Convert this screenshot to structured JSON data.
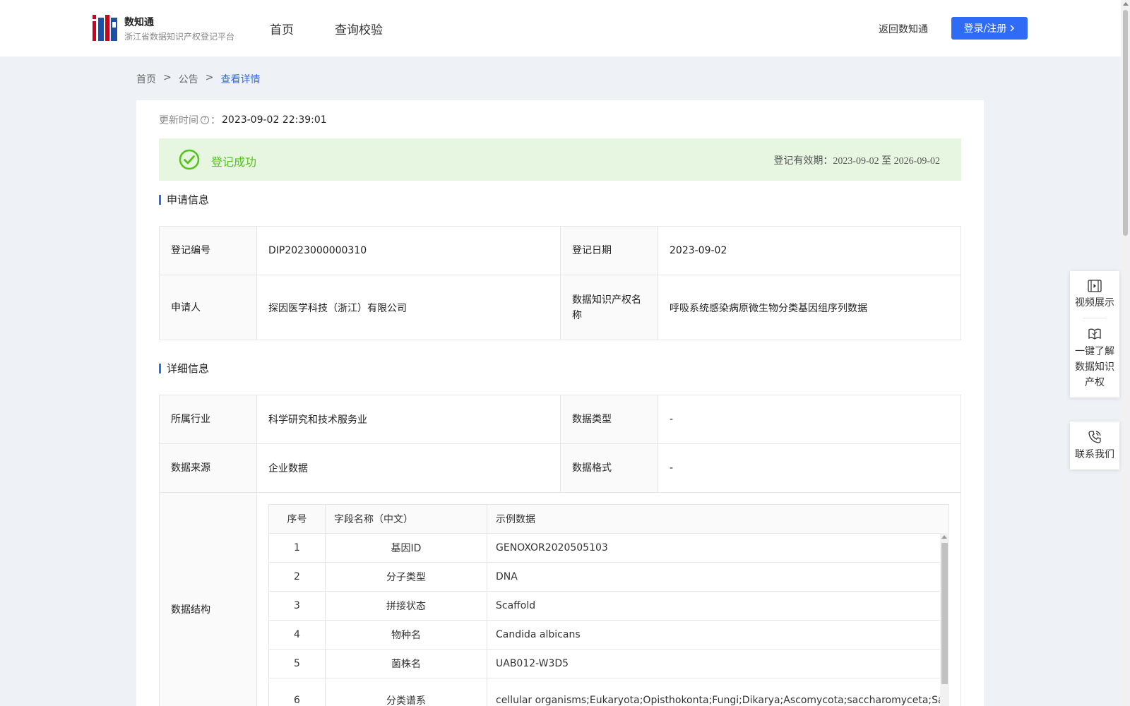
{
  "header": {
    "brand_title": "数知通",
    "brand_subtitle": "浙江省数据知识产权登记平台",
    "nav": [
      "首页",
      "查询校验"
    ],
    "back_link": "返回数知通",
    "login_label": "登录/注册"
  },
  "breadcrumb": {
    "items": [
      "首页",
      "公告",
      "查看详情"
    ],
    "separator": ">"
  },
  "update": {
    "label": "更新时间",
    "colon": "：",
    "value": "2023-09-02 22:39:01"
  },
  "status": {
    "text": "登记成功",
    "validity_label": "登记有效期：",
    "validity_range": "2023-09-02 至 2026-09-02",
    "color": "#52c41a"
  },
  "application": {
    "title": "申请信息",
    "reg_no_label": "登记编号",
    "reg_no": "DIP2023000000310",
    "reg_date_label": "登记日期",
    "reg_date": "2023-09-02",
    "applicant_label": "申请人",
    "applicant": "探因医学科技（浙江）有限公司",
    "ip_name_label": "数据知识产权名称",
    "ip_name": "呼吸系统感染病原微生物分类基因组序列数据"
  },
  "details": {
    "title": "详细信息",
    "industry_label": "所属行业",
    "industry": "科学研究和技术服务业",
    "data_type_label": "数据类型",
    "data_type": "-",
    "source_label": "数据来源",
    "source": "企业数据",
    "format_label": "数据格式",
    "format": "-",
    "structure_label": "数据结构"
  },
  "structure_table": {
    "headers": [
      "序号",
      "字段名称（中文）",
      "示例数据"
    ],
    "rows": [
      {
        "no": "1",
        "field": "基因ID",
        "sample": "GENOXOR2020505103"
      },
      {
        "no": "2",
        "field": "分子类型",
        "sample": "DNA"
      },
      {
        "no": "3",
        "field": "拼接状态",
        "sample": "Scaffold"
      },
      {
        "no": "4",
        "field": "物种名",
        "sample": "Candida albicans"
      },
      {
        "no": "5",
        "field": "菌株名",
        "sample": "UAB012-W3D5"
      },
      {
        "no": "6",
        "field": "分类谱系",
        "sample": "cellular organisms;Eukaryota;Opisthokonta;Fungi;Dikarya;Ascomycota;saccharomyceta;Saccharo"
      }
    ]
  },
  "side_panel": {
    "video": "视频展示",
    "learn": "一键了解数据知识产权",
    "contact": "联系我们"
  },
  "colors": {
    "accent": "#2f6bf5",
    "success_bg": "#e7f6e0"
  }
}
